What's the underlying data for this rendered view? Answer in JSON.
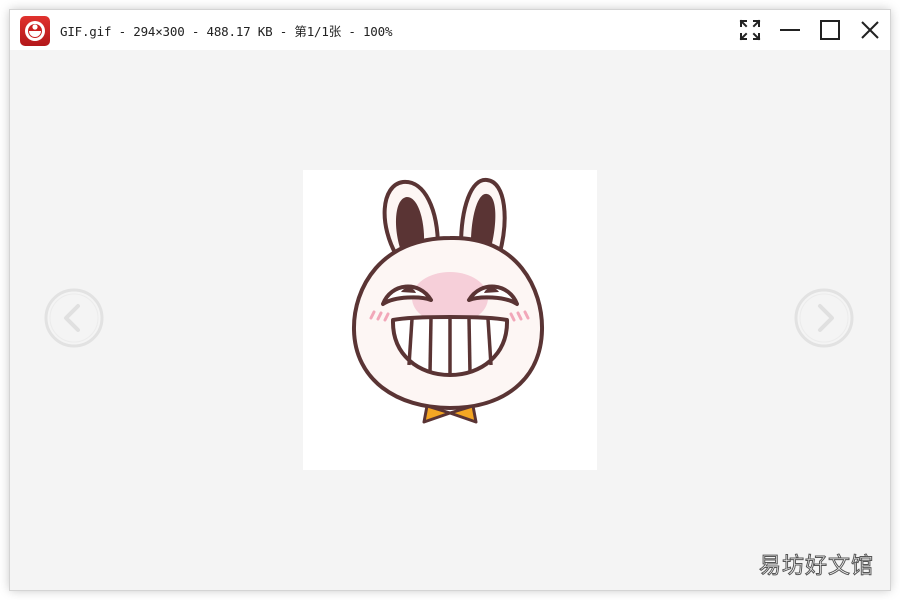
{
  "window": {
    "title": "GIF.gif - 294×300 - 488.17 KB - 第1/1张 - 100%",
    "app_icon": "photo-viewer-app-icon"
  },
  "toolbar": {
    "fullscreen_icon": "fullscreen-icon",
    "minimize_icon": "minimize-icon",
    "maximize_icon": "maximize-icon",
    "close_icon": "close-icon"
  },
  "viewer": {
    "image_subject": "rabbit-grin-sticker",
    "prev_icon": "chevron-left-icon",
    "next_icon": "chevron-right-icon"
  },
  "watermark": {
    "text": "易坊好文馆"
  },
  "colors": {
    "app_icon_red": "#d42a27",
    "viewer_background": "#f4f4f4",
    "rabbit_outline": "#5a3434",
    "rabbit_face": "#fdf6f4",
    "rabbit_ear_inner": "#5a3434",
    "blush": "#f2a7b9",
    "bowtie": "#f4a623"
  }
}
